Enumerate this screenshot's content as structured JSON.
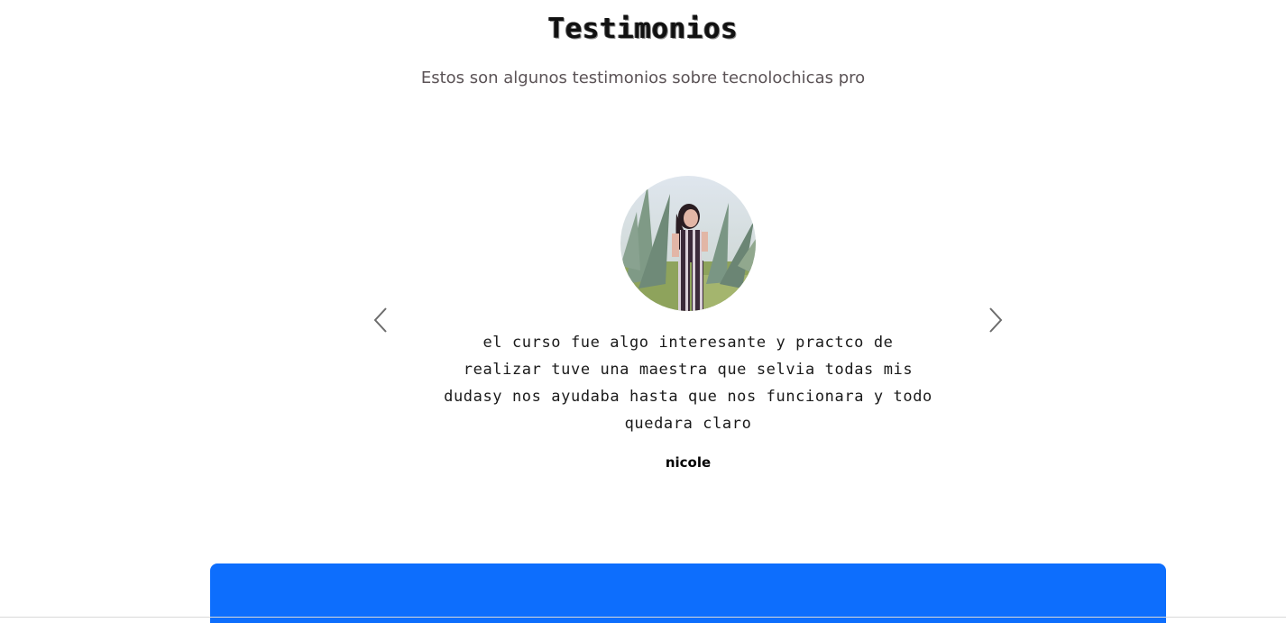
{
  "testimonials": {
    "title": "Testimonios",
    "subtitle": "Estos son algunos testimonios sobre tecnolochicas pro",
    "active": {
      "quote": "el curso fue algo interesante y practco de realizar tuve una maestra que selvia todas mis dudasy nos ayudaba hasta que nos funcionara y todo quedara claro",
      "author": "nicole"
    },
    "controls": {
      "prev_icon": "chevron-left-icon",
      "next_icon": "chevron-right-icon"
    }
  },
  "colors": {
    "banner": "#0d6efd",
    "subtitle": "#5b5356"
  }
}
